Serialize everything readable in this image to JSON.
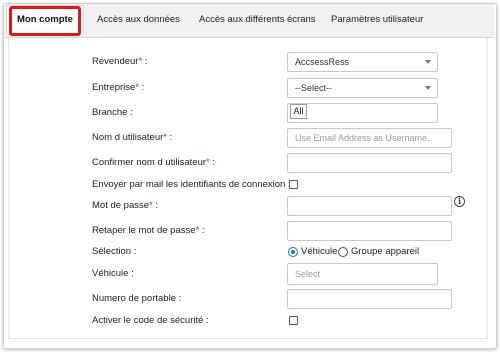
{
  "tabs": [
    {
      "label": "Mon compte"
    },
    {
      "label": "Accès aux données"
    },
    {
      "label": "Accès aux différents écrans"
    },
    {
      "label": "Paramètres utilisateur"
    }
  ],
  "form": {
    "revendeur": {
      "label": "Revendeur",
      "req": "*",
      "suffix": " :",
      "value": "AccsessRess"
    },
    "entreprise": {
      "label": "Entreprise",
      "req": "*",
      "suffix": " :",
      "value": "--Select--"
    },
    "branche": {
      "label": "Branche :",
      "value": "All"
    },
    "nom_utilisateur": {
      "label": "Nom d utilisateur",
      "req": "*",
      "suffix": " :",
      "placeholder": "Use Email Address as Username."
    },
    "confirmer_nom": {
      "label": "Confirmer nom d utilisateur",
      "req": "*",
      "suffix": " :"
    },
    "envoyer_mail": {
      "label": "Envoyer par mail les identifiants de connexion :"
    },
    "mot_de_passe": {
      "label": "Mot de passe",
      "req": "*",
      "suffix": " :",
      "info_icon": "i"
    },
    "retaper_mdp": {
      "label": "Retaper le mot de passe",
      "req": "*",
      "suffix": " :"
    },
    "selection": {
      "label": "Sélection :",
      "options": [
        "Véhicule",
        "Groupe appareil"
      ],
      "selected": "Véhicule"
    },
    "vehicule": {
      "label": "Véhicule :",
      "placeholder": "Select"
    },
    "portable": {
      "label": "Numero de portable :"
    },
    "code_securite": {
      "label": "Activer le code de sécurité :"
    }
  },
  "colors": {
    "required": "#d41b1b",
    "highlight": "#e01818",
    "radio_selected": "#1e73d8"
  }
}
